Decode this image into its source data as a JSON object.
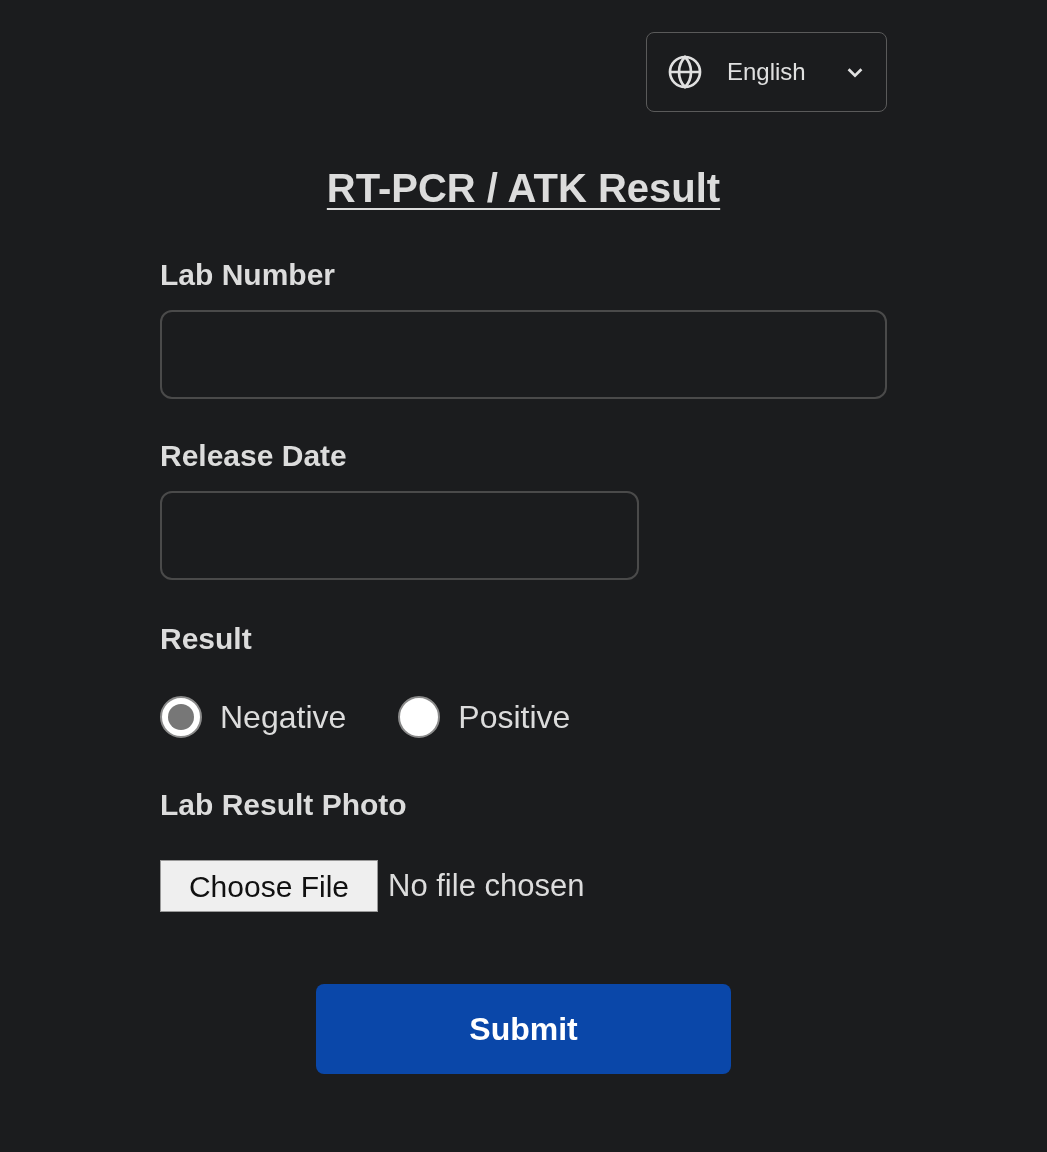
{
  "language_selector": {
    "value": "English"
  },
  "title": "RT-PCR / ATK Result",
  "fields": [
    {
      "label": "Lab Number",
      "kind": "text"
    },
    {
      "label": "Release Date",
      "kind": "date"
    }
  ],
  "result": {
    "label": "Result",
    "options": [
      {
        "label": "Negative",
        "selected": true
      },
      {
        "label": "Positive",
        "selected": false
      }
    ]
  },
  "photo": {
    "label": "Lab Result Photo",
    "button": "Choose File",
    "status": "No file chosen"
  },
  "submit": "Submit"
}
